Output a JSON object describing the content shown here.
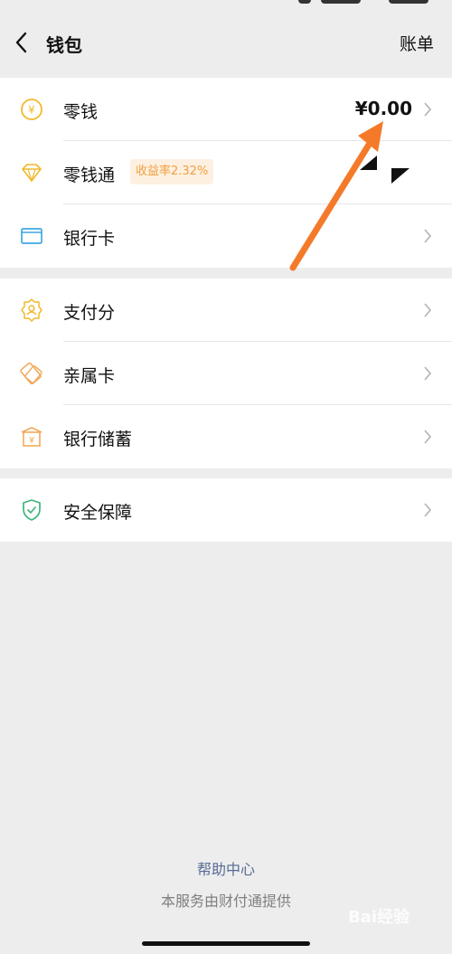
{
  "nav": {
    "title": "钱包",
    "right_action": "账单"
  },
  "groups": [
    {
      "items": [
        {
          "label": "零钱",
          "value": "¥0.00",
          "icon": "yuan-coin-icon"
        },
        {
          "label": "零钱通",
          "badge": "收益率2.32%",
          "icon": "diamond-icon"
        },
        {
          "label": "银行卡",
          "icon": "bank-card-icon"
        }
      ]
    },
    {
      "items": [
        {
          "label": "支付分",
          "icon": "badge-person-icon"
        },
        {
          "label": "亲属卡",
          "icon": "family-card-icon"
        },
        {
          "label": "银行储蓄",
          "icon": "bank-deposit-icon"
        }
      ]
    },
    {
      "items": [
        {
          "label": "安全保障",
          "icon": "shield-check-icon"
        }
      ]
    }
  ],
  "footer": {
    "help": "帮助中心",
    "provider": "本服务由财付通提供"
  },
  "watermark": "Bai经验",
  "colors": {
    "accent_yellow": "#f2b82b",
    "card_blue": "#3fa9e0",
    "shield_green": "#3fb67a",
    "link_blue": "#576b95",
    "arrow_orange": "#f47a2a"
  }
}
